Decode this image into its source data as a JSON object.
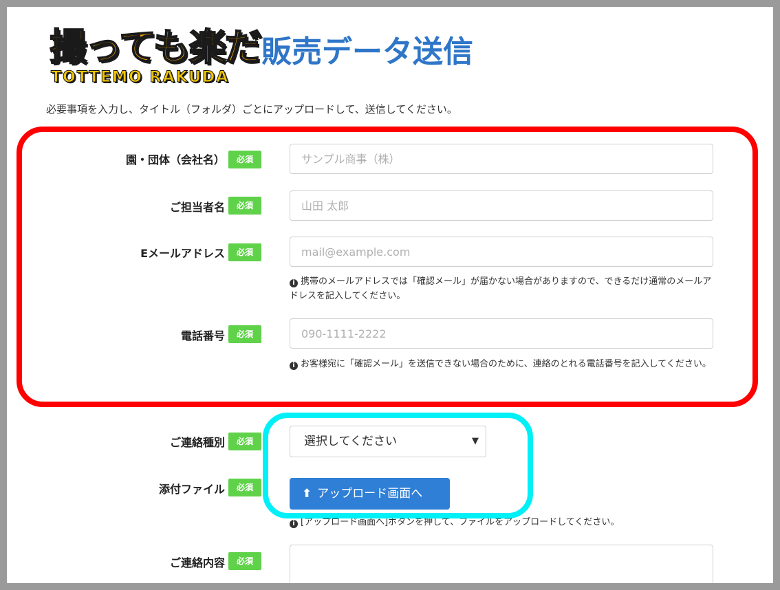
{
  "logo": {
    "main": "撮っても楽だ",
    "sub": "TOTTEMO RAKUDA"
  },
  "page_title": "販売データ送信",
  "intro": "必要事項を入力し、タイトル（フォルダ）ごとにアップロードして、送信してください。",
  "required_badge": "必須",
  "fields": {
    "company": {
      "label": "園・団体（会社名）",
      "placeholder": "サンプル商事（株）"
    },
    "person": {
      "label": "ご担当者名",
      "placeholder": "山田 太郎"
    },
    "email": {
      "label": "Eメールアドレス",
      "placeholder": "mail@example.com",
      "help": "携帯のメールアドレスでは「確認メール」が届かない場合がありますので、できるだけ通常のメールアドレスを記入してください。"
    },
    "phone": {
      "label": "電話番号",
      "placeholder": "090-1111-2222",
      "help": "お客様宛に「確認メール」を送信できない場合のために、連絡のとれる電話番号を記入してください。"
    },
    "contact_type": {
      "label": "ご連絡種別",
      "selected": "選択してください"
    },
    "attachment": {
      "label": "添付ファイル",
      "button": "アップロード画面へ",
      "help": "[アップロード画面へ]ボタンを押して、ファイルをアップロードしてください。"
    },
    "contact_content": {
      "label": "ご連絡内容"
    }
  },
  "icons": {
    "info": "info-circle-icon",
    "upload": "upload-icon",
    "caret": "caret-down-icon"
  },
  "colors": {
    "title": "#2f76c8",
    "badge": "#5fd24a",
    "button": "#2f7fd6",
    "highlight_red": "#ff0000",
    "highlight_cyan": "#00f0f8"
  }
}
